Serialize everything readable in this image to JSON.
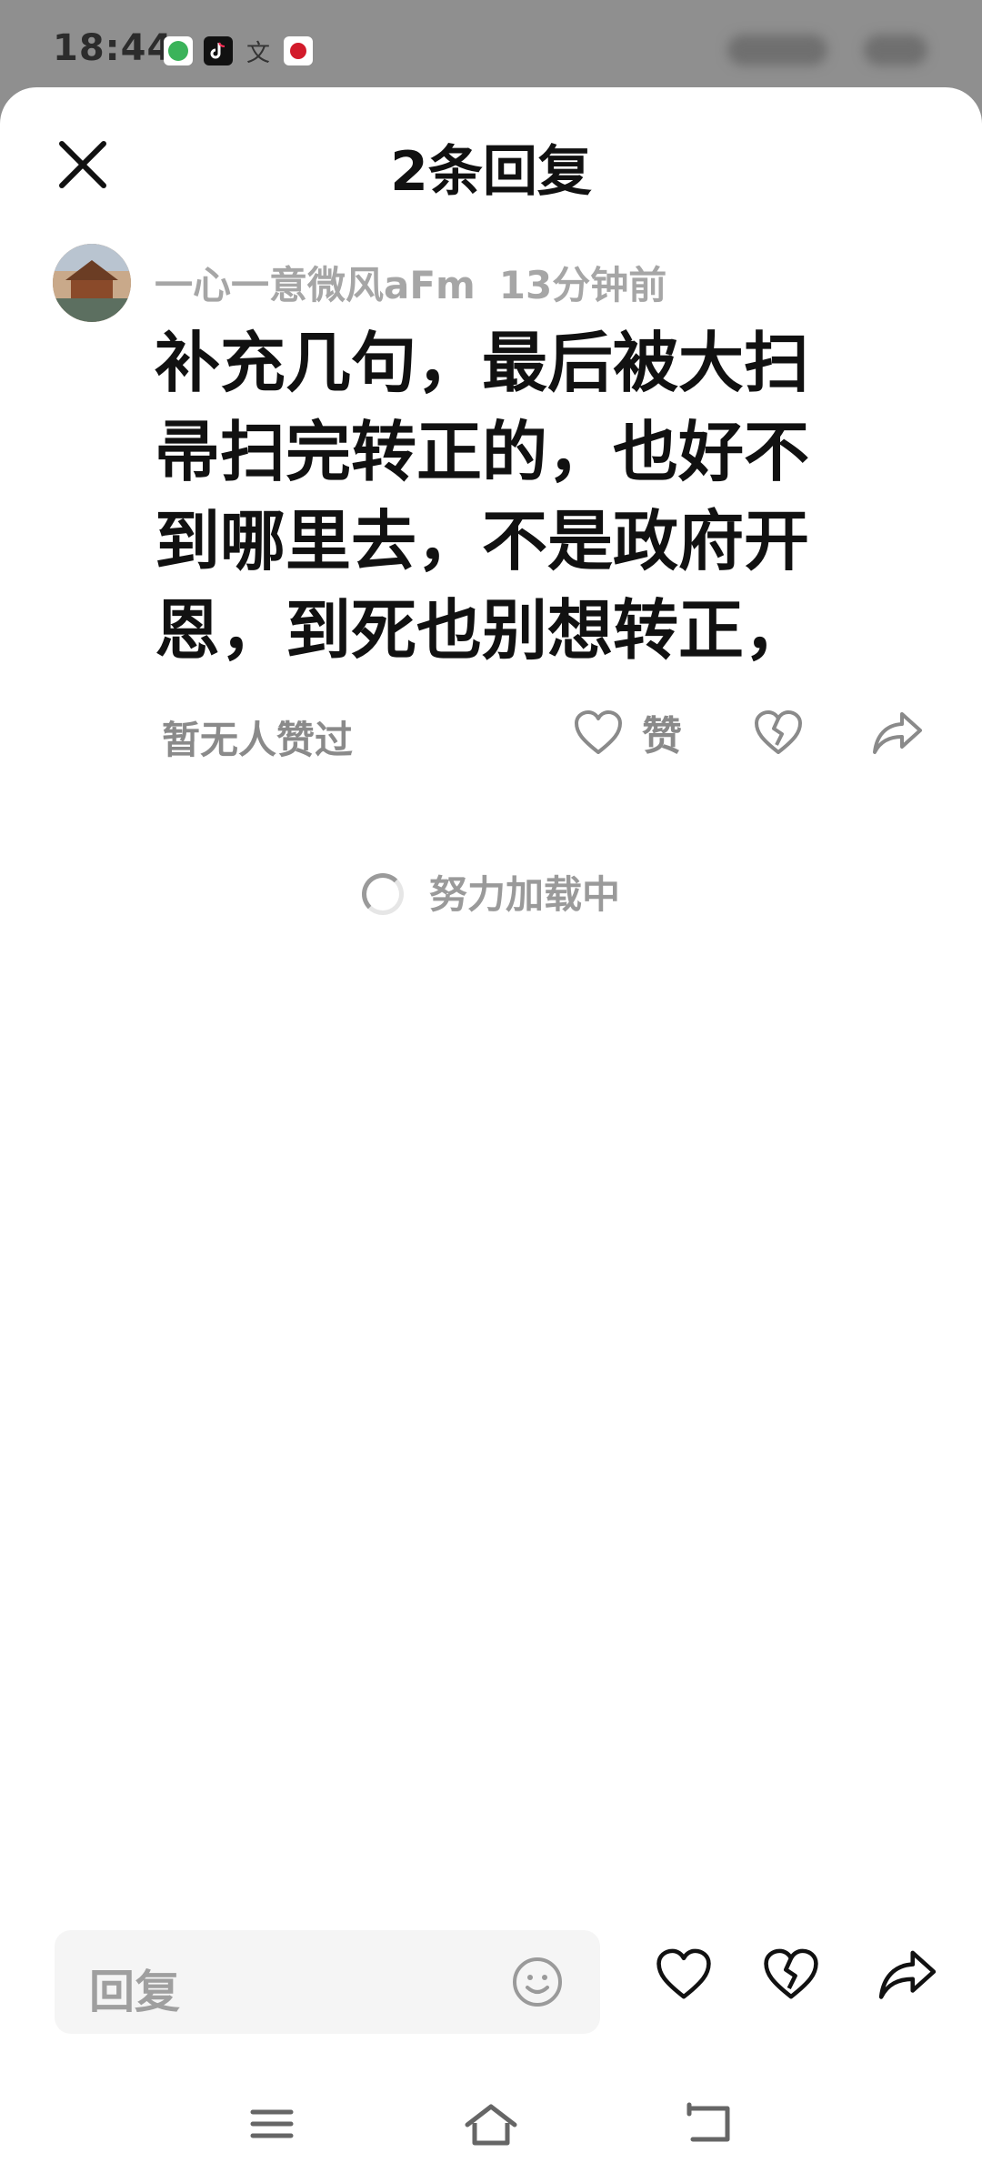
{
  "status_bar": {
    "time": "18:44",
    "icons": [
      "wechat-icon",
      "tiktok-icon",
      "translate-icon",
      "china-unicom-icon"
    ],
    "translate_glyph": "文"
  },
  "header": {
    "title": "2条回复",
    "close_icon": "close-icon"
  },
  "comment": {
    "author": "一心一意微风aFm",
    "time_ago": "13分钟前",
    "text": "补充几句，最后被大扫帚扫完转正的，也好不到哪里去，不是政府开恩，到死也别想转正，",
    "likes_text": "暂无人赞过",
    "like_label": "赞"
  },
  "loading": {
    "text": "努力加载中"
  },
  "reply_bar": {
    "placeholder": "回复"
  },
  "colors": {
    "status_bar_bg": "#8f8f8f",
    "sheet_bg": "#ffffff",
    "text_primary": "#111111",
    "text_secondary": "#a6a6a6",
    "input_bg": "#f5f5f5"
  }
}
